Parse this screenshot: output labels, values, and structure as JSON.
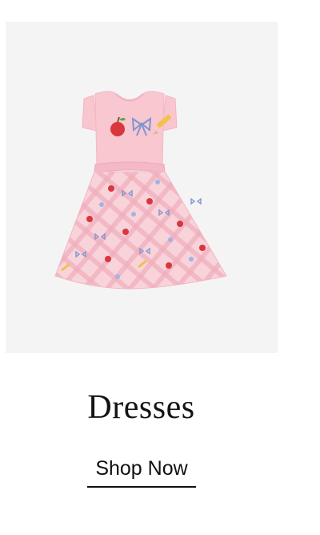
{
  "category": {
    "title": "Dresses",
    "cta_label": "Shop Now"
  },
  "product_image": {
    "subject": "dress-illustration",
    "colors": {
      "panel_bg": "#f4f4f4",
      "bodice": "#f8c7cf",
      "skirt": "#f6c6d0",
      "plaid": "#efa9b8",
      "apple": "#d9363e",
      "bow": "#7f95cf",
      "pencil": "#f2c14b"
    }
  }
}
